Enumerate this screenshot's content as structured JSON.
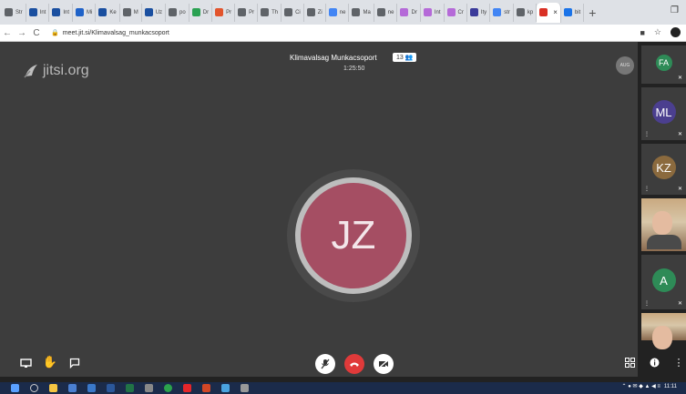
{
  "browser": {
    "tabs": [
      {
        "label": "Str",
        "color": "#5f6368"
      },
      {
        "label": "Int",
        "color": "#1a4fa0"
      },
      {
        "label": "Int",
        "color": "#1a4fa0"
      },
      {
        "label": "Mi",
        "color": "#1f62c8"
      },
      {
        "label": "Ke",
        "color": "#1a4fa0"
      },
      {
        "label": "M",
        "color": "#5f6368"
      },
      {
        "label": "Uz",
        "color": "#1a4fa0"
      },
      {
        "label": "po",
        "color": "#5f6368"
      },
      {
        "label": "Dr",
        "color": "#2aa152"
      },
      {
        "label": "Pr",
        "color": "#e2542c"
      },
      {
        "label": "Pr",
        "color": "#5f6368"
      },
      {
        "label": "Th",
        "color": "#5f6368"
      },
      {
        "label": "Ci",
        "color": "#5f6368"
      },
      {
        "label": "Zi",
        "color": "#5f6368"
      },
      {
        "label": "ne",
        "color": "#4285f4"
      },
      {
        "label": "Ma",
        "color": "#5f6368"
      },
      {
        "label": "ne",
        "color": "#5f6368"
      },
      {
        "label": "Dr",
        "color": "#b56ad8"
      },
      {
        "label": "Int",
        "color": "#b56ad8"
      },
      {
        "label": "Cr",
        "color": "#b56ad8"
      },
      {
        "label": "Ity",
        "color": "#3a3a9a"
      },
      {
        "label": "str",
        "color": "#4285f4"
      },
      {
        "label": "kp",
        "color": "#5f6368"
      },
      {
        "label": "",
        "color": "#d93025",
        "active": true
      },
      {
        "label": "bit",
        "color": "#1a73e8"
      }
    ],
    "new_tab": "+",
    "url": "meet.jit.si/Klimavalsag_munkacsoport"
  },
  "meeting": {
    "brand": "jitsi.org",
    "title": "Klimavalsag Munkacsoport",
    "participant_count": "13",
    "timer": "1:25:50",
    "self_badge": "AUG",
    "dominant_initials": "JZ",
    "dominant_color": "#a54e63"
  },
  "filmstrip": [
    {
      "initials": "FA",
      "color": "#2e8b57"
    },
    {
      "initials": "ML",
      "color": "#4b3f8f"
    },
    {
      "initials": "KZ",
      "color": "#8b6a3e"
    },
    {
      "initials": "",
      "video": true
    },
    {
      "initials": "A",
      "color": "#2e8b57"
    },
    {
      "initials": "",
      "video": true
    }
  ],
  "taskbar": {
    "clock": "11:11"
  }
}
